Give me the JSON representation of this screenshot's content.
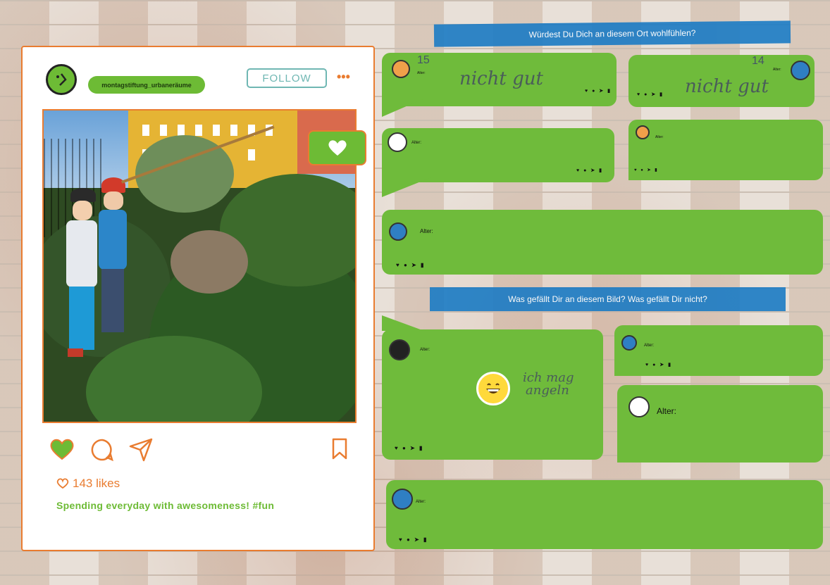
{
  "post": {
    "username": "montagstiftung_urbaneräume",
    "follow_label": "FOLLOW",
    "more_label": "•••",
    "likes_count": "143 likes",
    "caption": "Spending everyday with awesomeness! #fun"
  },
  "banners": {
    "question1": "Würdest Du Dich an diesem Ort wohlfühlen?",
    "question2": "Was gefällt Dir an diesem Bild? Was gefällt Dir nicht?"
  },
  "comments": {
    "alter_label": "Alter:",
    "icons_text": "♥ ● ➤ ▮",
    "c1_age": "15",
    "c1_text": "nicht gut",
    "c2_age": "14",
    "c2_text": "nicht gut",
    "c6_text_line1": "ich mag",
    "c6_text_line2": "angeln"
  },
  "colors": {
    "accent_orange": "#e97c30",
    "bubble_green": "#6fbb3b",
    "banner_blue": "#1b7bc4",
    "follow_teal": "#6fb7b3"
  },
  "icons": [
    "heart-icon",
    "comment-icon",
    "share-icon",
    "bookmark-icon",
    "more-icon"
  ]
}
